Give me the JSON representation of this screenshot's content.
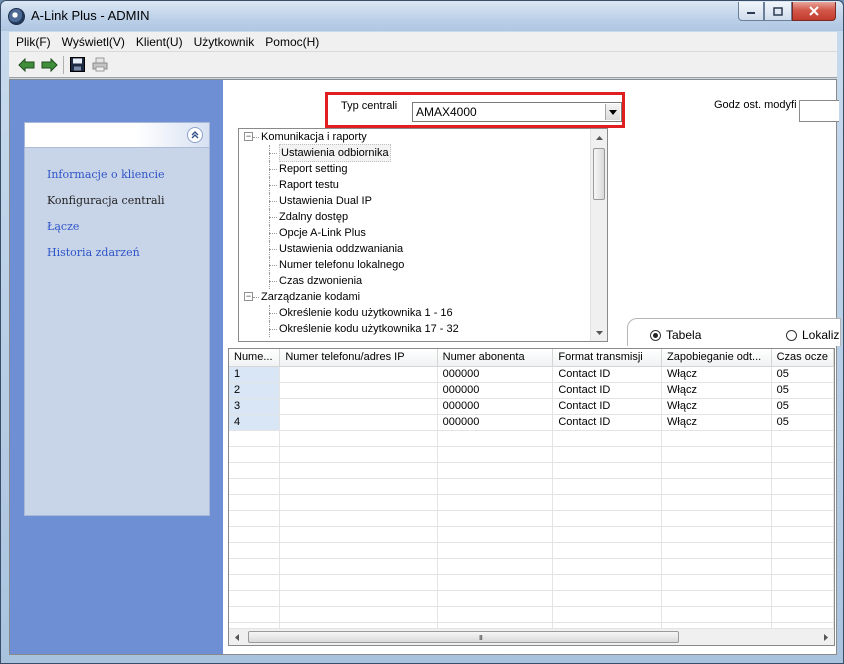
{
  "window": {
    "title": "A-Link Plus - ADMIN",
    "controls": [
      "minimize-icon",
      "maximize-icon",
      "close-icon"
    ]
  },
  "menu": [
    {
      "label": "Plik(F)"
    },
    {
      "label": "Wyświetl(V)"
    },
    {
      "label": "Klient(U)"
    },
    {
      "label": "Użytkownik"
    },
    {
      "label": "Pomoc(H)"
    }
  ],
  "toolbar": [
    "back-arrow-icon",
    "forward-arrow-icon",
    "save-icon",
    "print-icon"
  ],
  "sidebar": {
    "items": [
      {
        "label": "Informacje o kliencie",
        "active": false
      },
      {
        "label": "Konfiguracja centrali",
        "active": true
      },
      {
        "label": "Łącze",
        "active": false
      },
      {
        "label": "Historia zdarzeń",
        "active": false
      }
    ]
  },
  "panel": {
    "typ_label": "Typ centrali",
    "typ_value": "AMAX4000",
    "godz_label": "Godz ost. modyfi"
  },
  "tree": [
    {
      "label": "Komunikacja i raporty",
      "level": 0,
      "expanded": true
    },
    {
      "label": "Ustawienia odbiornika",
      "level": 1,
      "selected": true
    },
    {
      "label": "Report setting",
      "level": 1
    },
    {
      "label": "Raport testu",
      "level": 1
    },
    {
      "label": "Ustawienia Dual IP",
      "level": 1
    },
    {
      "label": "Zdalny dostęp",
      "level": 1
    },
    {
      "label": "Opcje A-Link Plus",
      "level": 1
    },
    {
      "label": "Ustawienia oddzwaniania",
      "level": 1
    },
    {
      "label": "Numer telefonu lokalnego",
      "level": 1
    },
    {
      "label": "Czas dzwonienia",
      "level": 1
    },
    {
      "label": "Zarządzanie kodami",
      "level": 0,
      "expanded": true
    },
    {
      "label": "Określenie kodu użytkownika 1 - 16",
      "level": 1
    },
    {
      "label": "Określenie kodu użytkownika 17 - 32",
      "level": 1
    }
  ],
  "view_toggle": {
    "options": [
      {
        "label": "Tabela",
        "selected": true
      },
      {
        "label": "Lokaliz",
        "selected": false
      }
    ]
  },
  "grid": {
    "columns": [
      "Nume...",
      "Numer telefonu/adres IP",
      "Numer abonenta",
      "Format transmisji",
      "Zapobieganie odt...",
      "Czas ocze"
    ],
    "rows": [
      [
        "1",
        "",
        "000000",
        "Contact ID",
        "Włącz",
        "05"
      ],
      [
        "2",
        "",
        "000000",
        "Contact ID",
        "Włącz",
        "05"
      ],
      [
        "3",
        "",
        "000000",
        "Contact ID",
        "Włącz",
        "05"
      ],
      [
        "4",
        "",
        "000000",
        "Contact ID",
        "Włącz",
        "05"
      ]
    ],
    "empty_rows": 14,
    "scroll_grip": "III"
  },
  "colors": {
    "sidebar_bg": "#6f8fd4",
    "nav_link": "#2f55c8",
    "highlight_frame": "#e02020",
    "index_cell": "#d9e6f5"
  }
}
